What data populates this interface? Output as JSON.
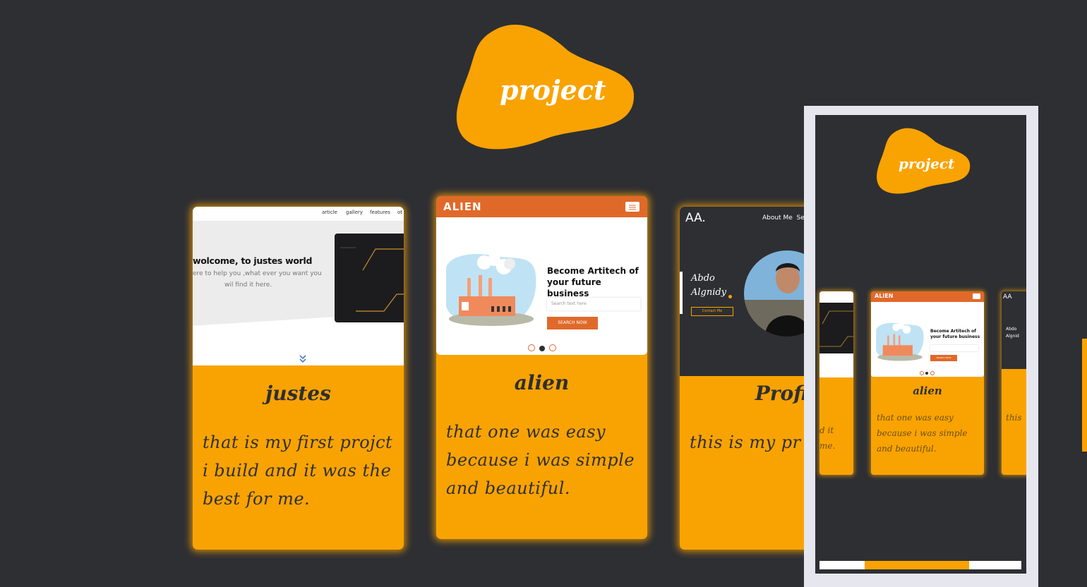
{
  "section": {
    "title": "project"
  },
  "colors": {
    "background": "#2e2f33",
    "accent": "#f9a302",
    "alien_orange": "#e0692a",
    "phone_frame": "#e6e6ef"
  },
  "cards": [
    {
      "title": "justes",
      "description": "that is my first projct i build and it was the best for me.",
      "preview": {
        "nav": [
          "article",
          "gallery",
          "features",
          "ot"
        ],
        "heading": "wolcome, to justes world",
        "text1": "ere to help you ,what ever you want you",
        "text2": "wil find it here.",
        "icon": "chevrons-down-icon"
      }
    },
    {
      "title": "alien",
      "description": "that one was easy because i was simple and beautiful.",
      "preview": {
        "brand": "ALIEN",
        "heading": "Become Artitech of your future business",
        "search_placeholder": "Search text here",
        "button": "SEARCH NOW",
        "icon": "menu-icon"
      }
    },
    {
      "title": "Profil",
      "description": "this is my pr",
      "preview": {
        "logo": "AA.",
        "nav": "About Me  Serv",
        "name1": "Abdo",
        "name2": "Algnidy",
        "button": "Contact Me"
      }
    }
  ],
  "phone": {
    "title": "project",
    "left_card": {
      "text1": "d it",
      "text2": "me."
    },
    "center_card": {
      "brand": "ALIEN",
      "heading": "Become Artitech of your future business",
      "title": "alien",
      "description": "that one was easy because i was simple and beautiful.",
      "button": "SEARCH NOW"
    },
    "right_card": {
      "logo": "AA",
      "name1": "Abdo",
      "name2": "Algnid",
      "text": "this"
    }
  }
}
